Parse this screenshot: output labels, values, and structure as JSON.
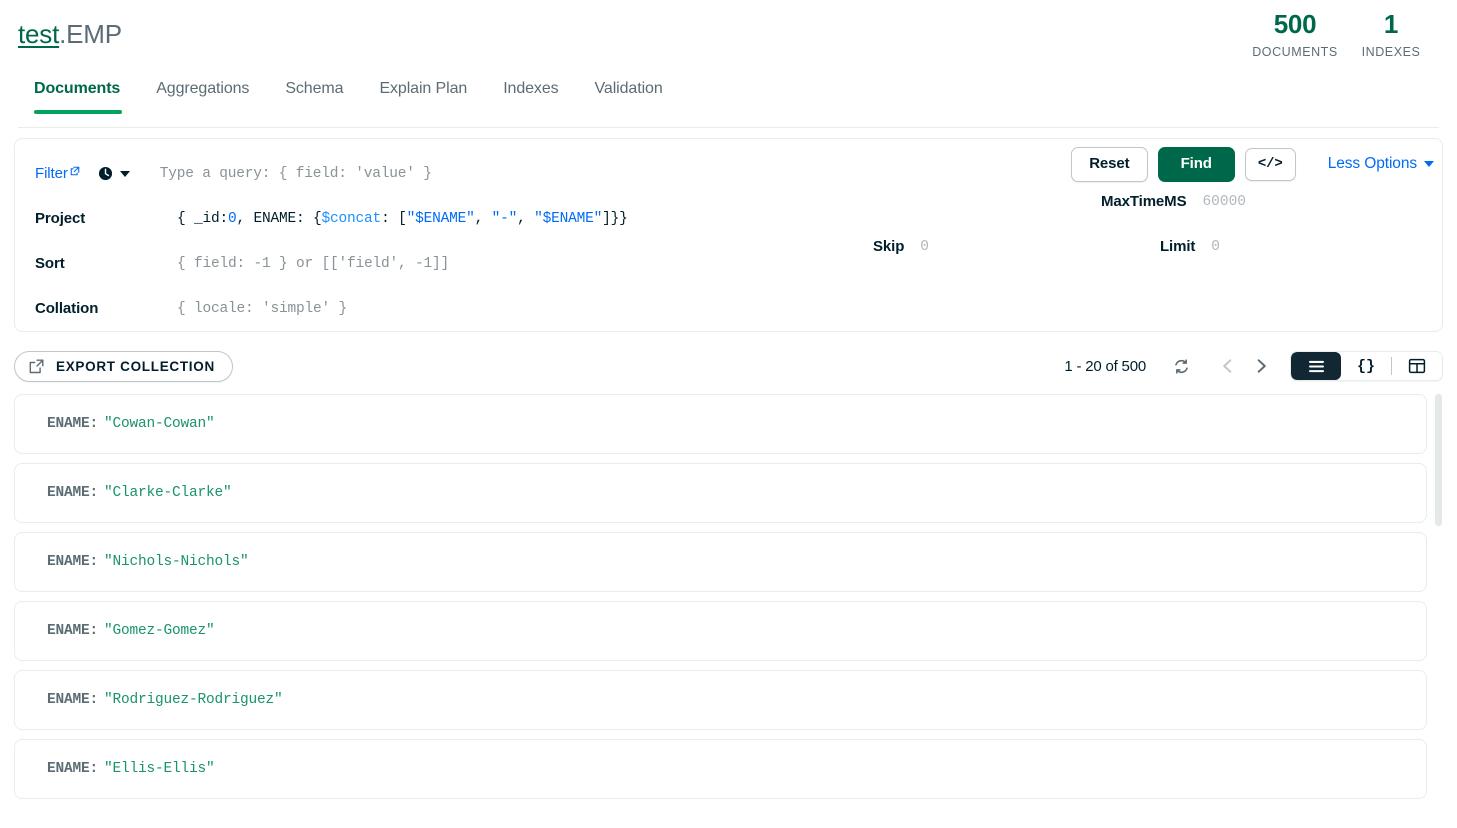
{
  "header": {
    "database": "test",
    "separator": ".",
    "collection": "EMP",
    "stats": [
      {
        "value": "500",
        "label": "DOCUMENTS"
      },
      {
        "value": "1",
        "label": "INDEXES"
      }
    ]
  },
  "tabs": [
    {
      "label": "Documents",
      "active": true
    },
    {
      "label": "Aggregations",
      "active": false
    },
    {
      "label": "Schema",
      "active": false
    },
    {
      "label": "Explain Plan",
      "active": false
    },
    {
      "label": "Indexes",
      "active": false
    },
    {
      "label": "Validation",
      "active": false
    }
  ],
  "query_bar": {
    "filter_label": "Filter",
    "filter_placeholder": "Type a query: { field: 'value' }",
    "filter_value": "",
    "history_icon": "clock-icon",
    "project_label": "Project",
    "project_value": "{ _id:0, ENAME: {$concat: [\"$ENAME\", \"-\", \"$ENAME\"]}}",
    "project_tokens": {
      "pre": "{ _id:",
      "zero": "0",
      "mid": ", ENAME: {",
      "concat": "$concat",
      "colon": ": [",
      "str1": "\"$ENAME\"",
      "comma1": ", ",
      "str2": "\"-\"",
      "comma2": ", ",
      "str3": "\"$ENAME\"",
      "post": "]}}"
    },
    "sort_label": "Sort",
    "sort_placeholder": "{ field: -1 } or [['field', -1]]",
    "sort_value": "",
    "collation_label": "Collation",
    "collation_placeholder": "{ locale: 'simple' }",
    "collation_value": "",
    "maxtimems_label": "MaxTimeMS",
    "maxtimems_placeholder": "60000",
    "maxtimems_value": "",
    "skip_label": "Skip",
    "skip_placeholder": "0",
    "skip_value": "",
    "limit_label": "Limit",
    "limit_placeholder": "0",
    "limit_value": "",
    "reset_label": "Reset",
    "find_label": "Find",
    "code_button_label": "</>",
    "options_toggle_label": "Less Options"
  },
  "toolbar": {
    "export_label": "EXPORT COLLECTION",
    "export_icon": "export-icon",
    "doc_range": "1 - 20 of 500",
    "refresh_icon": "refresh-icon",
    "prev_icon": "chevron-left-icon",
    "next_icon": "chevron-right-icon",
    "view_modes": [
      {
        "name": "list-view",
        "icon": "list-icon",
        "active": true
      },
      {
        "name": "json-view",
        "icon": "braces-icon",
        "label": "{}",
        "active": false
      },
      {
        "name": "table-view",
        "icon": "table-icon",
        "active": false
      }
    ]
  },
  "documents": [
    {
      "field": "ENAME",
      "value": "\"Cowan-Cowan\""
    },
    {
      "field": "ENAME",
      "value": "\"Clarke-Clarke\""
    },
    {
      "field": "ENAME",
      "value": "\"Nichols-Nichols\""
    },
    {
      "field": "ENAME",
      "value": "\"Gomez-Gomez\""
    },
    {
      "field": "ENAME",
      "value": "\"Rodriguez-Rodriguez\""
    },
    {
      "field": "ENAME",
      "value": "\"Ellis-Ellis\""
    }
  ],
  "colors": {
    "brand_green": "#00684a",
    "accent_green": "#00a35c",
    "link_blue": "#016bf8",
    "value_green": "#1a936f",
    "text_dark": "#001e2b",
    "text_muted": "#5c6c75",
    "placeholder": "#889397",
    "border": "#e8edeb",
    "toggle_dark": "#112733"
  }
}
